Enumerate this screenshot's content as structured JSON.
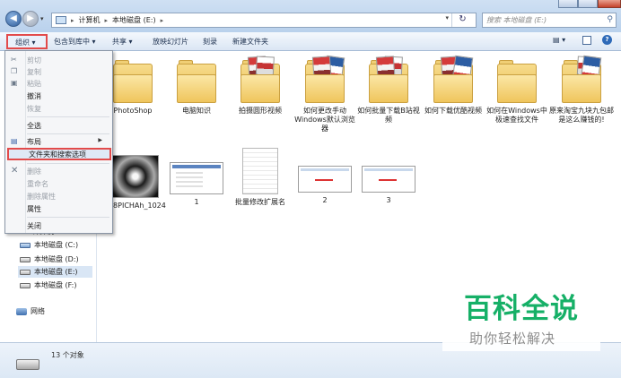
{
  "address": {
    "segments": [
      "计算机",
      "本地磁盘 (E:)"
    ],
    "search_placeholder": "搜索 本地磁盘 (E:)"
  },
  "toolbar": {
    "organize": "组织 ▾",
    "include_in_library": "包含到库中 ▾",
    "share": "共享 ▾",
    "slideshow": "放映幻灯片",
    "burn": "刻录",
    "new_folder": "新建文件夹"
  },
  "menu": {
    "cut": "剪切",
    "copy": "复制",
    "paste": "粘贴",
    "undo": "撤消",
    "redo": "恢复",
    "select_all": "全选",
    "layout": "布局",
    "folder_options": "文件夹和搜索选项",
    "delete": "删除",
    "rename": "重命名",
    "remove_properties": "删除属性",
    "properties": "属性",
    "close": "关闭"
  },
  "nav": {
    "computer": "计算机",
    "drive_c": "本地磁盘 (C:)",
    "drive_d": "本地磁盘 (D:)",
    "drive_e": "本地磁盘 (E:)",
    "drive_f": "本地磁盘 (F:)",
    "network": "网络"
  },
  "items": {
    "folder1": "PhotoShop",
    "folder2": "电脑知识",
    "folder3": "拍摄圆形视频",
    "folder4": "如何更改手动Windows默认浏览器",
    "folder5": "如何批量下载B站视频",
    "folder6": "如何下载优酷视频",
    "folder7": "如何在Windows中极速查找文件",
    "folder8": "原来淘宝九块九包邮是这么赚钱的!",
    "file1": "5x58PICHAh_1024",
    "file2": "1",
    "file3": "批量修改扩展名",
    "file4": "2",
    "file5": "3"
  },
  "status": {
    "count": "13 个对象"
  },
  "watermark": {
    "logo": "百科全说",
    "tagline": "助你轻松解决"
  },
  "colors": {
    "highlight_border": "#e24b4b",
    "watermark_green": "#16b067"
  }
}
